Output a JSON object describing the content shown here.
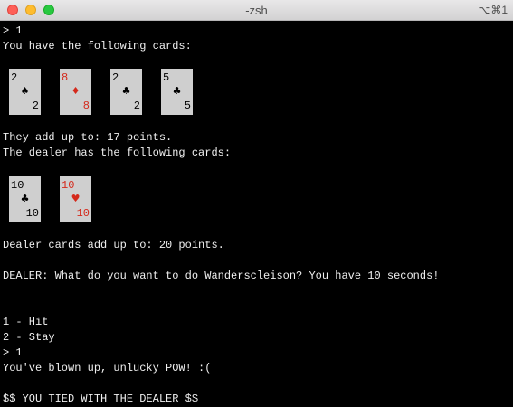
{
  "window": {
    "title": "-zsh",
    "shortcut": "⌥⌘1"
  },
  "terminal": {
    "lines": [
      "> 1",
      "You have the following cards:",
      "They add up to: 17 points.",
      "The dealer has the following cards:",
      "Dealer cards add up to: 20 points.",
      "DEALER: What do you want to do Wanderscleison? You have 10 seconds!",
      "1 - Hit",
      "2 - Stay",
      "> 1",
      "You've blown up, unlucky POW! :(",
      "$$ YOU TIED WITH THE DEALER $$"
    ],
    "player_cards": [
      {
        "rank": "2",
        "suit": "♠",
        "color": "#000000"
      },
      {
        "rank": "8",
        "suit": "♦",
        "color": "#d4291b"
      },
      {
        "rank": "2",
        "suit": "♣",
        "color": "#000000"
      },
      {
        "rank": "5",
        "suit": "♣",
        "color": "#000000"
      }
    ],
    "dealer_cards": [
      {
        "rank": "10",
        "suit": "♣",
        "color": "#000000"
      },
      {
        "rank": "10",
        "suit": "♥",
        "color": "#d4291b"
      }
    ]
  }
}
